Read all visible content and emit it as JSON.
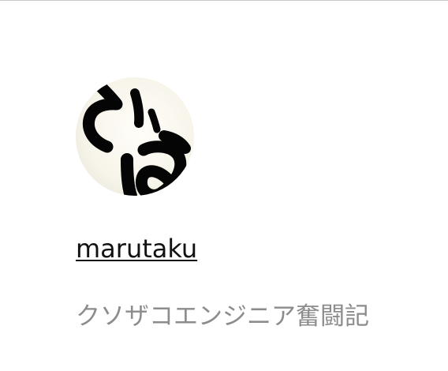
{
  "profile": {
    "avatar_icon": "handwritten-avatar-icon",
    "username": "marutaku",
    "tagline": "クソザコエンジニア奮闘記"
  },
  "colors": {
    "background": "#ffffff",
    "username_text": "#111111",
    "tagline_text": "#8c8c8c",
    "avatar_background": "#f7f5ee"
  }
}
